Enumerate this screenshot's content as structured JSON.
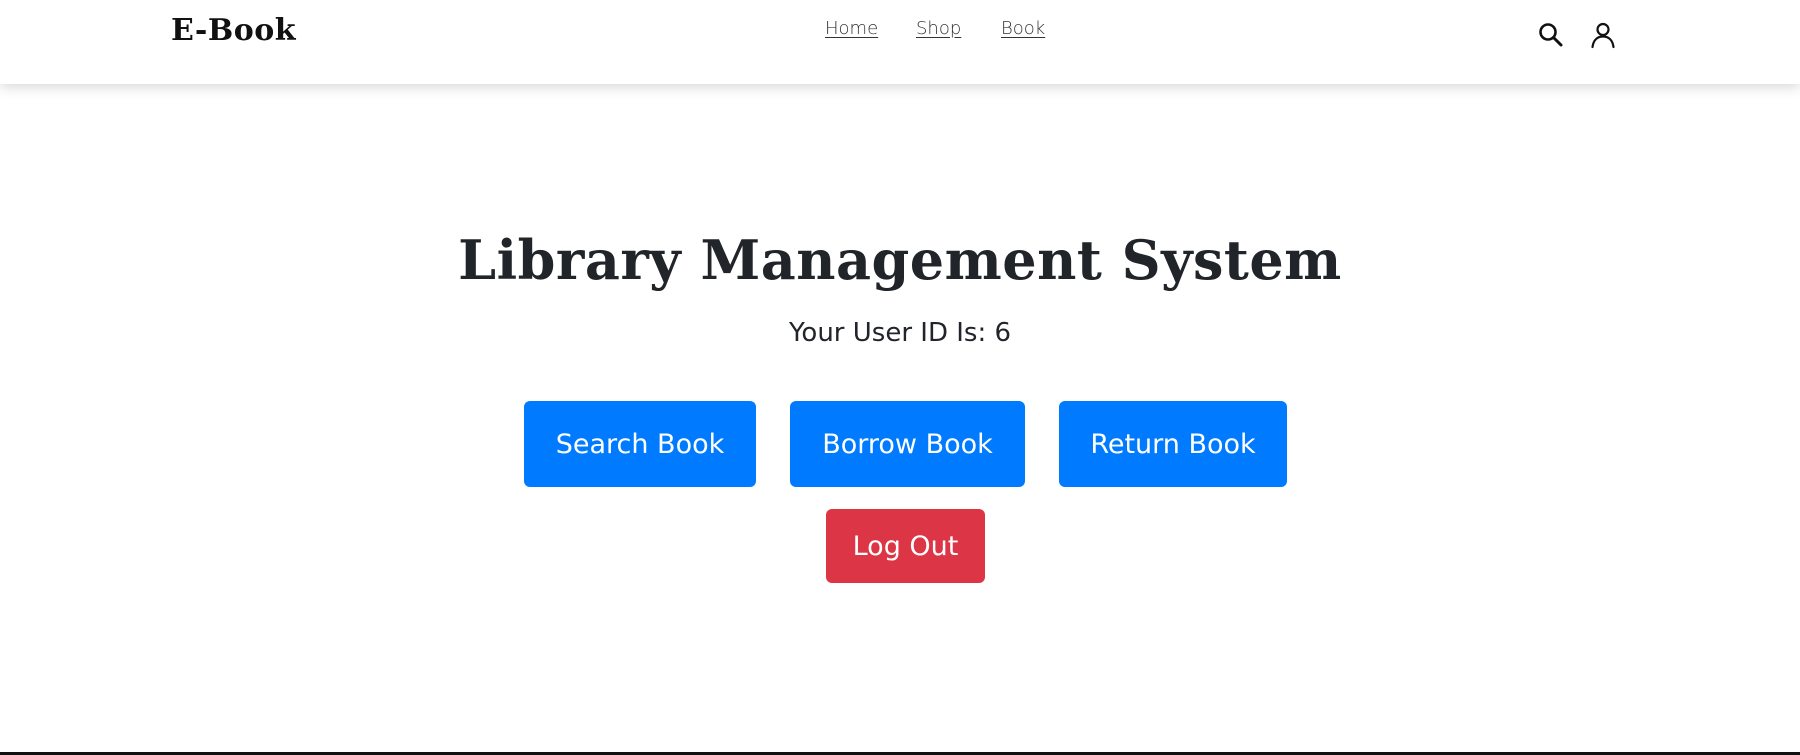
{
  "navbar": {
    "brand": "E-Book",
    "links": [
      {
        "label": "Home"
      },
      {
        "label": "Shop"
      },
      {
        "label": "Book"
      }
    ],
    "icons": [
      "search-icon",
      "user-icon"
    ]
  },
  "main": {
    "title": "Library Management System",
    "user_id_text": "Your User ID Is: 6",
    "buttons": {
      "search": "Search Book",
      "borrow": "Borrow Book",
      "return": "Return Book",
      "logout": "Log Out"
    }
  },
  "colors": {
    "primary": "#007bff",
    "danger": "#dc3545",
    "text": "#212529"
  }
}
